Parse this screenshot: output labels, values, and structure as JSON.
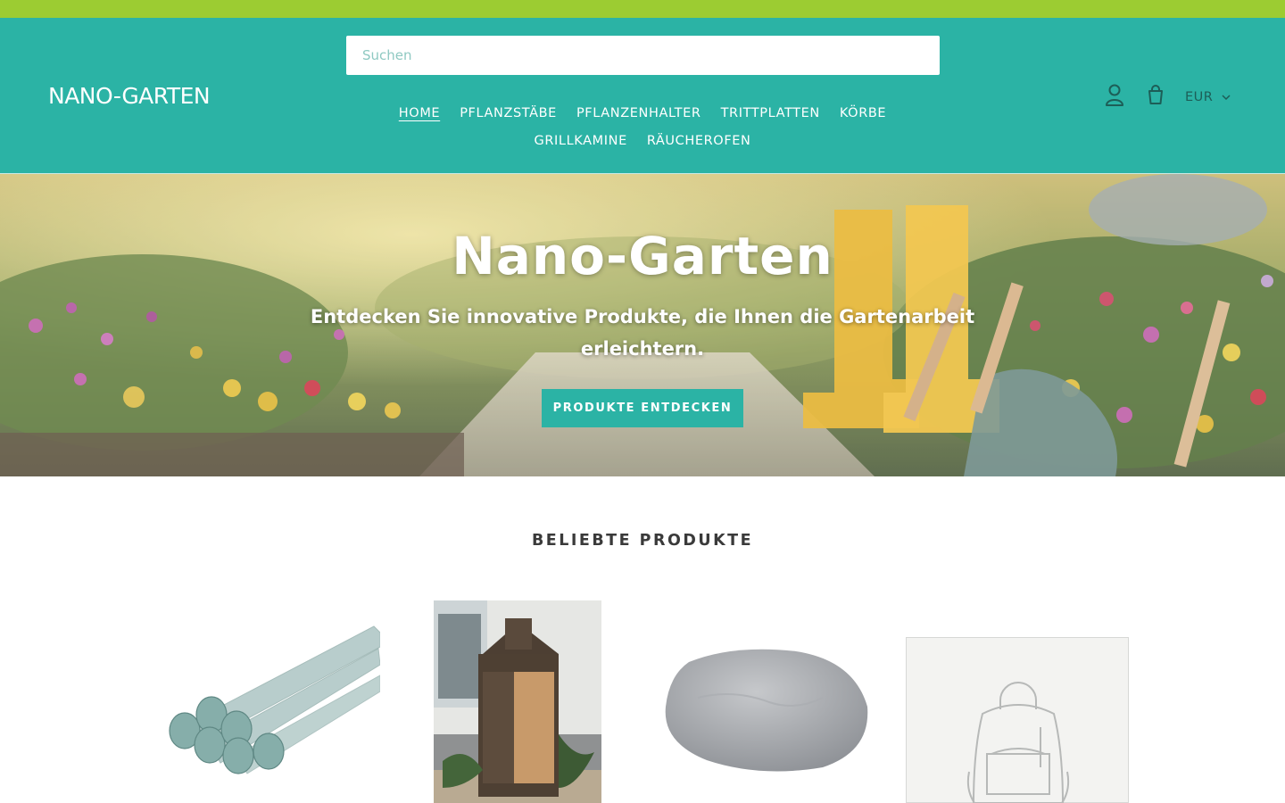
{
  "colors": {
    "announcement": "#9ccc32",
    "header": "#2bb3a5",
    "button": "#2bb3a5",
    "text_dark": "#3a3a3a"
  },
  "header": {
    "logo_text": "NANO-GARTEN",
    "search": {
      "placeholder": "Suchen"
    },
    "nav": [
      {
        "label": "HOME",
        "active": true
      },
      {
        "label": "PFLANZSTÄBE"
      },
      {
        "label": "PFLANZENHALTER"
      },
      {
        "label": "TRITTPLATTEN"
      },
      {
        "label": "KÖRBE"
      },
      {
        "label": "GRILLKAMINE"
      },
      {
        "label": "RÄUCHEROFEN"
      }
    ],
    "icons": {
      "account": "account-icon",
      "cart": "cart-icon",
      "chevron": "chevron-down-icon"
    },
    "currency": "EUR"
  },
  "hero": {
    "title": "Nano-Garten",
    "subtitle": "Entdecken Sie innovative Produkte, die Ihnen die Gartenarbeit erleichtern.",
    "button_label": "PRODUKTE ENTDECKEN"
  },
  "featured": {
    "title": "BELIEBTE PRODUKTE",
    "products": [
      {
        "image": "plant-stakes-image"
      },
      {
        "image": "smoker-cabinet-image"
      },
      {
        "image": "stepping-stone-image"
      },
      {
        "image": "placeholder-backpack-image"
      }
    ]
  }
}
